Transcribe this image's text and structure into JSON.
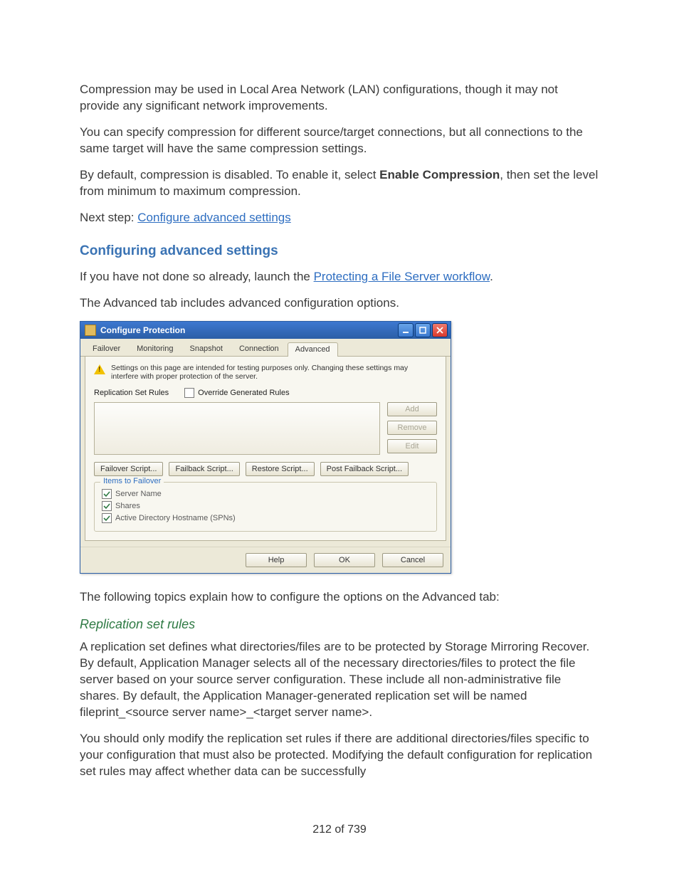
{
  "paragraphs": {
    "p1": "Compression may be used in Local Area Network (LAN) configurations, though it may not provide any significant network improvements.",
    "p2": "You can specify compression for different source/target connections, but all connections to the same target will have the same compression settings.",
    "p3a": "By default, compression is disabled. To enable it, select ",
    "p3_bold": "Enable Compression",
    "p3b": ", then set the level from minimum to maximum compression.",
    "p4a": "Next step: ",
    "p4_link": "Configure advanced settings",
    "p5a": "If you have not done so already, launch the ",
    "p5_link": "Protecting a File Server workflow",
    "p5b": ".",
    "p6": "The Advanced tab includes advanced configuration options.",
    "p7": "The following topics explain how to configure the options on the Advanced tab:",
    "p8": "A replication set defines what directories/files are to be protected by Storage Mirroring Recover. By default, Application Manager selects all of the necessary directories/files to protect the file server based on your source server configuration. These include all non-administrative file shares. By default, the Application Manager-generated replication set will be named fileprint_<source server name>_<target server name>.",
    "p9": "You should only modify the replication set rules if there are additional directories/files specific to your configuration that must also be protected. Modifying the default configuration for replication set rules may affect whether data can be successfully"
  },
  "headings": {
    "h2": "Configuring advanced settings",
    "h3": "Replication set rules"
  },
  "dialog": {
    "title": "Configure Protection",
    "tabs": [
      "Failover",
      "Monitoring",
      "Snapshot",
      "Connection",
      "Advanced"
    ],
    "active_tab_index": 4,
    "warning": "Settings on this page are intended for testing purposes only.  Changing these settings may interfere with proper protection of the server.",
    "rules_label": "Replication Set Rules",
    "override_label": "Override Generated Rules",
    "override_checked": false,
    "side_buttons": [
      {
        "label": "Add",
        "enabled": false
      },
      {
        "label": "Remove",
        "enabled": false
      },
      {
        "label": "Edit",
        "enabled": false
      }
    ],
    "script_buttons": [
      "Failover Script...",
      "Failback Script...",
      "Restore Script...",
      "Post Failback Script..."
    ],
    "items_group_title": "Items to Failover",
    "items": [
      {
        "label": "Server Name",
        "checked": true
      },
      {
        "label": "Shares",
        "checked": true
      },
      {
        "label": "Active Directory Hostname (SPNs)",
        "checked": true
      }
    ],
    "bottom_buttons": [
      "Help",
      "OK",
      "Cancel"
    ]
  },
  "page_number": "212 of 739"
}
